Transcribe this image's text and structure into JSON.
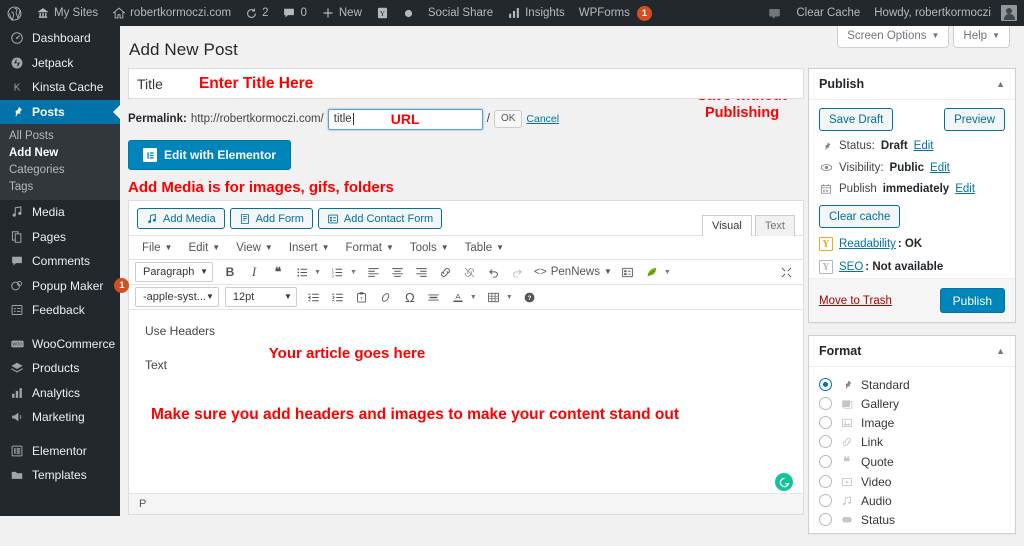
{
  "adminbar": {
    "left_items": [
      {
        "name": "wp-logo",
        "icon": "wordpress-icon",
        "label": ""
      },
      {
        "name": "my-sites",
        "icon": "sites-icon",
        "label": "My Sites"
      },
      {
        "name": "site-name",
        "icon": "home-icon",
        "label": "robertkormoczi.com"
      },
      {
        "name": "updates",
        "icon": "updates-icon",
        "label": "2"
      },
      {
        "name": "comments",
        "icon": "comment-icon",
        "label": "0"
      },
      {
        "name": "new-content",
        "icon": "plus-icon",
        "label": "New"
      },
      {
        "name": "yoast",
        "icon": "yoast-icon",
        "label": ""
      },
      {
        "name": "dot",
        "icon": "circle-icon",
        "label": ""
      },
      {
        "name": "social-share",
        "icon": "",
        "label": "Social Share"
      },
      {
        "name": "insights",
        "icon": "bars-icon",
        "label": "Insights"
      },
      {
        "name": "wpforms",
        "icon": "",
        "label": "WPForms",
        "badge": "1"
      }
    ],
    "right_items": [
      {
        "name": "notifications",
        "icon": "speech-icon",
        "label": ""
      },
      {
        "name": "clear-cache",
        "icon": "",
        "label": "Clear Cache"
      },
      {
        "name": "howdy",
        "icon": "",
        "label": "Howdy, robertkormoczi"
      }
    ]
  },
  "sidebar": {
    "items": [
      {
        "label": "Dashboard",
        "icon": "dashboard-icon",
        "current": false
      },
      {
        "label": "Jetpack",
        "icon": "jetpack-icon",
        "current": false
      },
      {
        "label": "Kinsta Cache",
        "icon": "kinsta-icon",
        "current": false
      },
      {
        "label": "Posts",
        "icon": "pin-icon",
        "current": true
      },
      {
        "label": "Media",
        "icon": "media-icon",
        "current": false
      },
      {
        "label": "Pages",
        "icon": "pages-icon",
        "current": false
      },
      {
        "label": "Comments",
        "icon": "comments-icon",
        "current": false
      },
      {
        "label": "Popup Maker",
        "icon": "popup-icon",
        "current": false,
        "badge": "1"
      },
      {
        "label": "Feedback",
        "icon": "feedback-icon",
        "current": false
      },
      {
        "label": "WooCommerce",
        "icon": "woo-icon",
        "current": false
      },
      {
        "label": "Products",
        "icon": "products-icon",
        "current": false
      },
      {
        "label": "Analytics",
        "icon": "analytics-icon",
        "current": false
      },
      {
        "label": "Marketing",
        "icon": "marketing-icon",
        "current": false
      },
      {
        "label": "Elementor",
        "icon": "elementor-icon",
        "current": false
      },
      {
        "label": "Templates",
        "icon": "templates-icon",
        "current": false
      }
    ],
    "posts_submenu": [
      {
        "label": "All Posts",
        "current": false
      },
      {
        "label": "Add New",
        "current": true
      },
      {
        "label": "Categories",
        "current": false
      },
      {
        "label": "Tags",
        "current": false
      }
    ]
  },
  "screenmeta": {
    "screen_options": "Screen Options",
    "help": "Help"
  },
  "page": {
    "title": "Add New Post"
  },
  "title_field": {
    "value": "Title"
  },
  "permalink": {
    "label": "Permalink:",
    "base": "http://robertkormoczi.com/",
    "slug": "title",
    "trailing": "/",
    "ok": "OK",
    "cancel": "Cancel"
  },
  "elementor": {
    "label": "Edit with Elementor"
  },
  "annotations": {
    "title": "Enter Title Here",
    "url": "URL",
    "save_without_publishing": "Save without Publishing",
    "add_media": "Add Media is for images, gifs, folders",
    "article_goes_here": "Your article goes here",
    "headers_images": "Make sure you add headers and images to make your content stand out",
    "color": "#ff0000"
  },
  "editor": {
    "media_buttons": [
      {
        "label": "Add Media",
        "icon": "media-icon"
      },
      {
        "label": "Add Form",
        "icon": "form-icon"
      },
      {
        "label": "Add Contact Form",
        "icon": "contact-form-icon"
      }
    ],
    "tabs": [
      {
        "label": "Visual",
        "active": true
      },
      {
        "label": "Text",
        "active": false
      }
    ],
    "menubar": [
      "File",
      "Edit",
      "View",
      "Insert",
      "Format",
      "Tools",
      "Table"
    ],
    "toolbar2": {
      "paragraph_select": "Paragraph",
      "bold": "B",
      "italic": "I",
      "blockquote": "❝",
      "bullet_list": "bullet-list-icon",
      "numbered_list": "numbered-list-icon",
      "align_left": "align-left-icon",
      "align_center": "align-center-icon",
      "align_right": "align-right-icon",
      "link": "link-icon",
      "unlink": "unlink-icon",
      "undo": "undo-icon",
      "redo": "redo-icon",
      "pennews": "PenNews",
      "page_builder": "page-builder-icon",
      "leaf": "leaf-icon",
      "fullscreen": "fullscreen-icon"
    },
    "toolbar3": {
      "font_family": "-apple-syst...",
      "font_size": "12pt",
      "outdent": "outdent-icon",
      "indent": "indent-icon",
      "paste_text": "paste-text-icon",
      "clear_format": "clear-format-icon",
      "special_char": "Ω",
      "horizontal_rule": "hr-icon",
      "text_color": "A",
      "table": "table-icon",
      "help": "help-icon"
    },
    "content": {
      "line1": "Use Headers",
      "line2": "Text"
    },
    "statusbar": "P"
  },
  "publish_box": {
    "title": "Publish",
    "save_draft": "Save Draft",
    "preview": "Preview",
    "status_label": "Status:",
    "status_value": "Draft",
    "status_edit": "Edit",
    "visibility_label": "Visibility:",
    "visibility_value": "Public",
    "visibility_edit": "Edit",
    "publish_label": "Publish",
    "publish_value": "immediately",
    "publish_edit": "Edit",
    "clear_cache": "Clear cache",
    "readability_label": "Readability",
    "readability_value": ": OK",
    "seo_label": "SEO",
    "seo_value": ": Not available",
    "move_to_trash": "Move to Trash",
    "publish_button": "Publish"
  },
  "format_box": {
    "title": "Format",
    "options": [
      {
        "label": "Standard",
        "icon": "pin-icon",
        "selected": true
      },
      {
        "label": "Gallery",
        "icon": "gallery-icon",
        "selected": false
      },
      {
        "label": "Image",
        "icon": "image-icon",
        "selected": false
      },
      {
        "label": "Link",
        "icon": "link-icon",
        "selected": false
      },
      {
        "label": "Quote",
        "icon": "quote-icon",
        "selected": false
      },
      {
        "label": "Video",
        "icon": "video-icon",
        "selected": false
      },
      {
        "label": "Audio",
        "icon": "audio-icon",
        "selected": false
      },
      {
        "label": "Status",
        "icon": "status-icon",
        "selected": false
      }
    ]
  },
  "colors": {
    "admin_bar": "#23282d",
    "sidebar": "#23282d",
    "current_menu": "#0073aa",
    "primary_button": "#0085ba",
    "annotation_red": "#ff0000",
    "trash_red": "#a00",
    "grammarly_green": "#15c39a"
  }
}
